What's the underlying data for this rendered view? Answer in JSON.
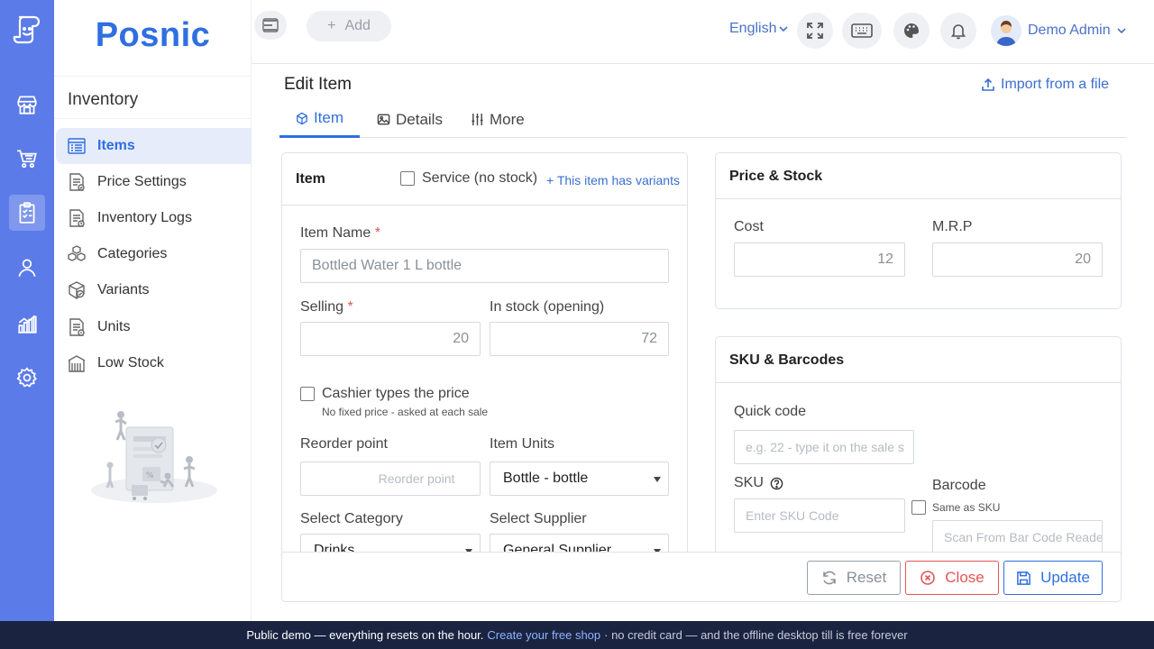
{
  "brand": {
    "name": "Posnic"
  },
  "sidemenu": {
    "title": "Inventory",
    "items": [
      {
        "label": "Items",
        "icon": "list-icon",
        "active": true
      },
      {
        "label": "Price Settings",
        "icon": "price-doc-icon"
      },
      {
        "label": "Inventory Logs",
        "icon": "log-doc-icon"
      },
      {
        "label": "Categories",
        "icon": "boxes-icon"
      },
      {
        "label": "Variants",
        "icon": "variant-box-icon"
      },
      {
        "label": "Units",
        "icon": "units-doc-icon"
      },
      {
        "label": "Low Stock",
        "icon": "warehouse-icon"
      }
    ]
  },
  "rail": {
    "items": [
      "store-icon",
      "cart-icon",
      "clipboard-icon",
      "user-icon",
      "chart-icon",
      "gear-icon"
    ],
    "active_index": 2
  },
  "topbar": {
    "add_label": "Add",
    "language": "English",
    "user_name": "Demo Admin"
  },
  "page": {
    "title": "Edit Item",
    "import_label": "Import from a file",
    "tabs": [
      {
        "label": "Item",
        "icon": "cube-icon",
        "active": true
      },
      {
        "label": "Details",
        "icon": "image-icon"
      },
      {
        "label": "More",
        "icon": "sliders-icon"
      }
    ]
  },
  "item_card": {
    "title": "Item",
    "service_label": "Service (no stock)",
    "variants_link": "+ This item has variants",
    "item_name_label": "Item Name",
    "item_name_placeholder": "Bottled Water 1 L bottle",
    "selling_label": "Selling",
    "selling_value": "20",
    "stock_label": "In stock (opening)",
    "stock_value": "72",
    "cashier_label": "Cashier types the price",
    "cashier_hint": "No fixed price - asked at each sale",
    "reorder_label": "Reorder point",
    "reorder_placeholder": "Reorder point",
    "units_label": "Item Units",
    "units_value": "Bottle - bottle",
    "category_label": "Select Category",
    "category_value": "Drinks",
    "supplier_label": "Select Supplier",
    "supplier_value": "General Supplier",
    "required_mark": "*"
  },
  "price_card": {
    "title": "Price & Stock",
    "cost_label": "Cost",
    "cost_value": "12",
    "mrp_label": "M.R.P",
    "mrp_value": "20"
  },
  "sku_card": {
    "title": "SKU & Barcodes",
    "quick_label": "Quick code",
    "quick_placeholder": "e.g. 22 - type it on the sale s",
    "sku_label": "SKU",
    "sku_placeholder": "Enter SKU Code",
    "barcode_label": "Barcode",
    "same_as_sku": "Same as SKU",
    "barcode_placeholder": "Scan From Bar Code Reade"
  },
  "actions": {
    "reset": "Reset",
    "close": "Close",
    "update": "Update"
  },
  "footer": {
    "lead": "Public demo — everything resets on the hour.",
    "link": "Create your free shop",
    "tail": "· no credit card — and the offline desktop till is free forever"
  },
  "colors": {
    "rail": "#5b7be8",
    "accent": "#2f6fe0",
    "danger": "#e25555",
    "footer_bg": "#1a2340"
  }
}
